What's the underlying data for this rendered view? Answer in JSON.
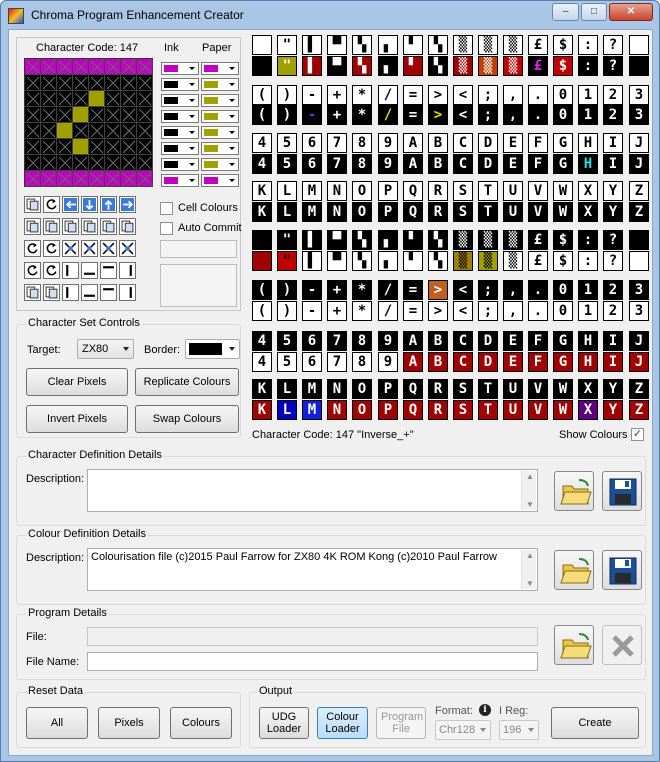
{
  "window": {
    "title": "Chroma Program Enhancement Creator",
    "min": "–",
    "max": "□",
    "close": "✕"
  },
  "editor": {
    "char_code_label": "Character Code: 147",
    "ink_label": "Ink",
    "paper_label": "Paper",
    "cell_colours_label": "Cell Colours",
    "auto_commit_label": "Auto Commit",
    "ink_colors": [
      "#c000c0",
      "#000000",
      "#000000",
      "#000000",
      "#000000",
      "#000000",
      "#000000",
      "#c000c0"
    ],
    "paper_colors": [
      "#c000c0",
      "#a0a000",
      "#a0a000",
      "#a0a000",
      "#a0a000",
      "#a0a000",
      "#a0a000",
      "#c000c0"
    ]
  },
  "charset_controls": {
    "group_label": "Character Set Controls",
    "target_label": "Target:",
    "target_value": "ZX80",
    "border_label": "Border:",
    "clear_pixels": "Clear Pixels",
    "replicate_colours": "Replicate Colours",
    "invert_pixels": "Invert Pixels",
    "swap_colours": "Swap Colours"
  },
  "charset_panel": {
    "selected_info": "Character Code: 147  \"Inverse_+\"",
    "show_colours_label": "Show Colours",
    "show_colours_checked": "✓",
    "row_glyphs": [
      [
        " ",
        "\"",
        "▌",
        "▀",
        "▚",
        "▖",
        "▘",
        "▚",
        "▒",
        "▒",
        "▒",
        "£",
        "$",
        ":",
        "?"
      ],
      [
        "(",
        ")",
        "-",
        "+",
        "*",
        "/",
        "=",
        ">",
        "<",
        ";",
        ",",
        ".",
        "0",
        "1",
        "2",
        "3"
      ],
      [
        "4",
        "5",
        "6",
        "7",
        "8",
        "9",
        "A",
        "B",
        "C",
        "D",
        "E",
        "F",
        "G",
        "H",
        "I",
        "J"
      ],
      [
        "K",
        "L",
        "M",
        "N",
        "O",
        "P",
        "Q",
        "R",
        "S",
        "T",
        "U",
        "V",
        "W",
        "X",
        "Y",
        "Z"
      ]
    ]
  },
  "char_def": {
    "group_label": "Character Definition Details",
    "desc_label": "Description:",
    "desc_value": ""
  },
  "colour_def": {
    "group_label": "Colour Definition Details",
    "desc_label": "Description:",
    "desc_value": "Colourisation file (c)2015 Paul Farrow for ZX80 4K ROM Kong (c)2010 Paul Farrow"
  },
  "program": {
    "group_label": "Program Details",
    "file_label": "File:",
    "file_value": "",
    "filename_label": "File Name:",
    "filename_value": ""
  },
  "reset": {
    "group_label": "Reset Data",
    "all": "All",
    "pixels": "Pixels",
    "colours": "Colours"
  },
  "output": {
    "group_label": "Output",
    "udg_loader": "UDG Loader",
    "colour_loader": "Colour Loader",
    "program_file": "Program File",
    "format_label": "Format:",
    "format_value": "Chr128",
    "ireg_label": "I Reg:",
    "ireg_value": "196",
    "create": "Create",
    "info_icon": "i"
  }
}
